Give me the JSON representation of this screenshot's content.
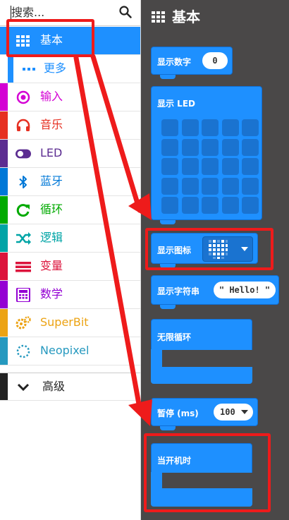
{
  "search": {
    "placeholder": "搜索..."
  },
  "categories": [
    {
      "label": "基本",
      "color": "#1e90ff",
      "icon": "grid-icon"
    },
    {
      "label": "更多",
      "color": "#1e90ff",
      "icon": "dots-icon"
    },
    {
      "label": "输入",
      "color": "#d400d4",
      "icon": "target-icon"
    },
    {
      "label": "音乐",
      "color": "#e63022",
      "icon": "headphones-icon"
    },
    {
      "label": "LED",
      "color": "#5c2d91",
      "icon": "toggle-icon"
    },
    {
      "label": "蓝牙",
      "color": "#0078d7",
      "icon": "bluetooth-icon"
    },
    {
      "label": "循环",
      "color": "#00aa00",
      "icon": "loop-icon"
    },
    {
      "label": "逻辑",
      "color": "#00a4a6",
      "icon": "shuffle-icon"
    },
    {
      "label": "变量",
      "color": "#dc143c",
      "icon": "list-icon"
    },
    {
      "label": "数学",
      "color": "#9400d3",
      "icon": "calculator-icon"
    },
    {
      "label": "SuperBit",
      "color": "#eca314",
      "icon": "gears-icon"
    },
    {
      "label": "Neopixel",
      "color": "#2699bf",
      "icon": "ring-icon"
    },
    {
      "label": "高级",
      "color": "#222222",
      "icon": "chevron-down-icon"
    }
  ],
  "workspace": {
    "title": "基本",
    "blocks": {
      "show_number": {
        "label": "显示数字",
        "value": "0"
      },
      "show_led": {
        "label": "显示 LED"
      },
      "show_icon": {
        "label": "显示图标"
      },
      "show_string": {
        "label": "显示字符串",
        "value": "\" Hello! \""
      },
      "forever": {
        "label": "无限循环"
      },
      "pause": {
        "label": "暂停 (ms)",
        "value": "100"
      },
      "on_start": {
        "label": "当开机时"
      }
    }
  },
  "colors": {
    "accent": "#1e90ff",
    "workspace_bg": "#4a4848",
    "highlight": "#ee1b1b"
  }
}
